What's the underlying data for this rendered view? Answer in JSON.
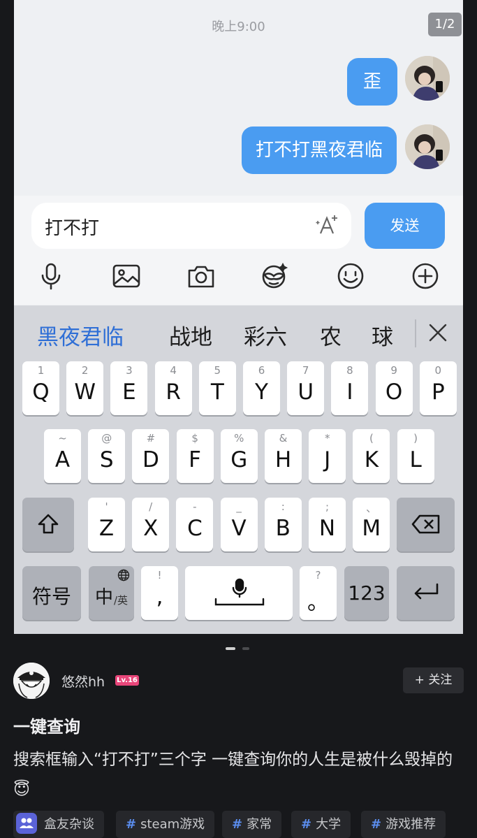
{
  "chat": {
    "time": "晚上9:00",
    "pager": "1/2",
    "messages": [
      {
        "text": "歪"
      },
      {
        "text": "打不打黑夜君临"
      }
    ]
  },
  "input": {
    "value": "打不打",
    "send_label": "发送"
  },
  "toolbar": {
    "icons": [
      "microphone-icon",
      "image-icon",
      "camera-icon",
      "sticker-icon",
      "emoji-icon",
      "plus-icon"
    ]
  },
  "keyboard": {
    "candidates": [
      "黑夜君临",
      "战地",
      "彩六",
      "农",
      "球"
    ],
    "row1": [
      {
        "key": "Q",
        "hint": "1"
      },
      {
        "key": "W",
        "hint": "2"
      },
      {
        "key": "E",
        "hint": "3"
      },
      {
        "key": "R",
        "hint": "4"
      },
      {
        "key": "T",
        "hint": "5"
      },
      {
        "key": "Y",
        "hint": "6"
      },
      {
        "key": "U",
        "hint": "7"
      },
      {
        "key": "I",
        "hint": "8"
      },
      {
        "key": "O",
        "hint": "9"
      },
      {
        "key": "P",
        "hint": "0"
      }
    ],
    "row2": [
      {
        "key": "A",
        "hint": "~"
      },
      {
        "key": "S",
        "hint": "@"
      },
      {
        "key": "D",
        "hint": "#"
      },
      {
        "key": "F",
        "hint": "$"
      },
      {
        "key": "G",
        "hint": "%"
      },
      {
        "key": "H",
        "hint": "&"
      },
      {
        "key": "J",
        "hint": "*"
      },
      {
        "key": "K",
        "hint": "("
      },
      {
        "key": "L",
        "hint": ")"
      }
    ],
    "row3": [
      {
        "key": "Z",
        "hint": "'"
      },
      {
        "key": "X",
        "hint": "/"
      },
      {
        "key": "C",
        "hint": "-"
      },
      {
        "key": "V",
        "hint": "_"
      },
      {
        "key": "B",
        "hint": ":"
      },
      {
        "key": "N",
        "hint": ";"
      },
      {
        "key": "M",
        "hint": "、"
      }
    ],
    "symbols_label": "符号",
    "lang_main": "中",
    "lang_sub": "/英",
    "comma": ",",
    "comma_hint": "!",
    "period": "。",
    "period_hint": "?",
    "num_label": "123"
  },
  "post": {
    "author": "悠然hh",
    "level": "Lv.16",
    "follow_label": "+ 关注",
    "title": "一键查询",
    "body": "搜索框输入“打不打”三个字 一键查询你的人生是被什么毁掉的😇",
    "circle_tag": "盒友杂谈",
    "tags": [
      "steam游戏",
      "家常",
      "大学",
      "游戏推荐"
    ]
  }
}
